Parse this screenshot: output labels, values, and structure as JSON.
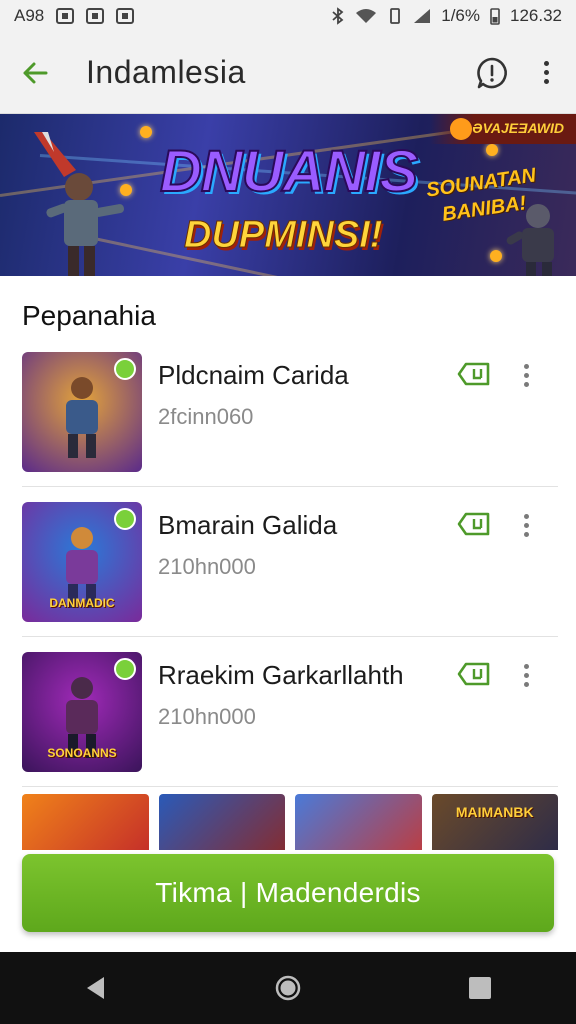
{
  "status_bar": {
    "left_text": "A98",
    "battery": "1/6%",
    "time": "126.32"
  },
  "app_bar": {
    "title": "Indamlesia",
    "icons": [
      "back-arrow-icon",
      "chat-icon",
      "more-vert-icon"
    ]
  },
  "banner": {
    "corner_text": "ƏVAJEƎAWID",
    "title_line1": "DNUANIS",
    "title_line2": "DUPMINSI!",
    "side_text_line1": "SOUNATAN",
    "side_text_line2": "BANIBA!"
  },
  "section": {
    "title": "Pepanahia"
  },
  "items": [
    {
      "name": "Pldcnaim Carida",
      "sub": "2fcinn060",
      "thumb_caption": "",
      "thumb_colors": [
        "#e3a33b",
        "#5a2a8a"
      ]
    },
    {
      "name": "Bmarain Galida",
      "sub": "210hn000",
      "thumb_caption": "DANMADIC",
      "thumb_colors": [
        "#2a7ad8",
        "#7a2a9a"
      ]
    },
    {
      "name": "Rraekim Garkarllahth",
      "sub": "210hn000",
      "thumb_caption": "SONOANNS",
      "thumb_colors": [
        "#a02ab8",
        "#3a145a"
      ]
    }
  ],
  "strip": [
    {
      "caption": "",
      "colors": [
        "#f0821a",
        "#c22a2a"
      ]
    },
    {
      "caption": "",
      "colors": [
        "#2a5ab8",
        "#8a2a2a"
      ]
    },
    {
      "caption": "",
      "colors": [
        "#4a7ad8",
        "#c23a3a"
      ]
    },
    {
      "caption": "MAIMANBK",
      "colors": [
        "#6a4a2a",
        "#2a2a4a"
      ]
    }
  ],
  "cta": {
    "label": "Tikma | Madenderdis"
  },
  "colors": {
    "accent_green": "#6cb524",
    "icon_green": "#4e9a2a"
  },
  "nav_bar": {
    "icons": [
      "nav-back-icon",
      "nav-home-icon",
      "nav-recents-icon"
    ]
  }
}
